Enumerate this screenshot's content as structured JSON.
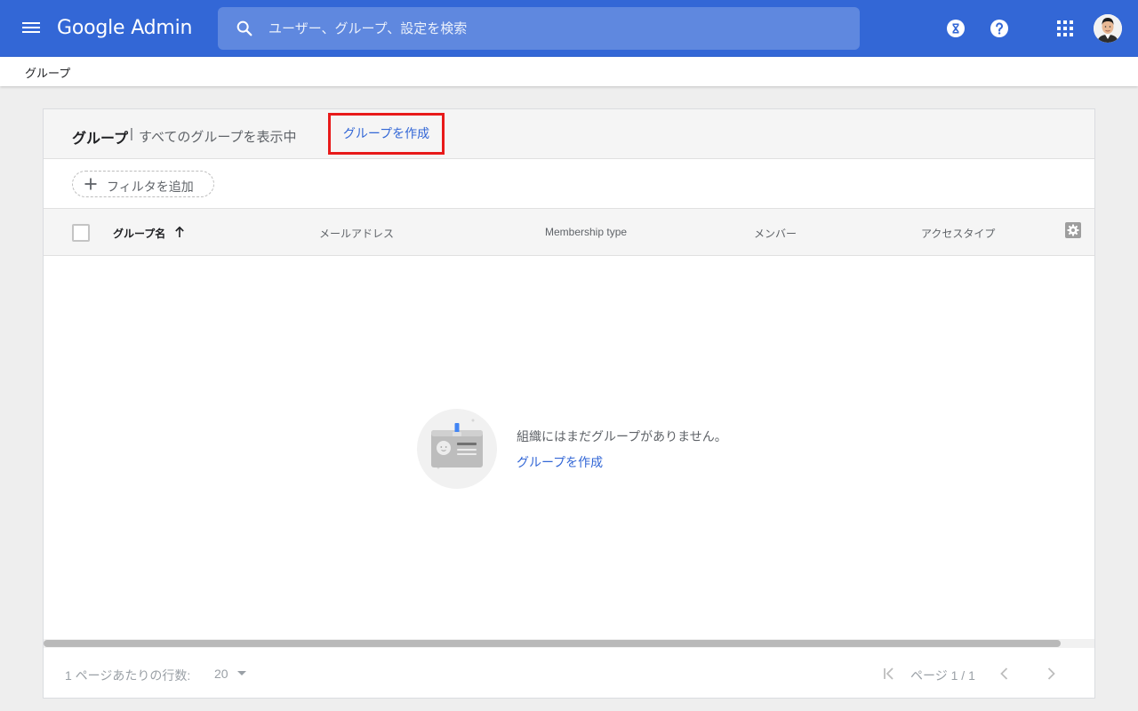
{
  "app": {
    "logo_google": "Google",
    "logo_admin": "Admin"
  },
  "search": {
    "placeholder": "ユーザー、グループ、設定を検索"
  },
  "icons": {
    "menu": "menu-icon",
    "search": "search-icon",
    "hourglass": "hourglass-icon",
    "help": "help-icon",
    "apps": "apps-grid-icon",
    "avatar": "user-avatar",
    "add": "plus-icon",
    "sort": "arrow-up-icon",
    "settings": "gear-icon",
    "first_page": "first-page-icon",
    "prev_page": "chevron-left-icon",
    "next_page": "chevron-right-icon"
  },
  "colors": {
    "appbar": "#3367d6",
    "link": "#3367d6",
    "highlight_border": "#e81a1a"
  },
  "breadcrumb": "グループ",
  "card": {
    "title": "グループ",
    "separator": "|",
    "subtitle": "すべてのグループを表示中",
    "create_label": "グループを作成"
  },
  "filter": {
    "label": "フィルタを追加"
  },
  "table": {
    "columns": [
      "グループ名",
      "メールアドレス",
      "Membership type",
      "メンバー",
      "アクセスタイプ"
    ]
  },
  "empty_state": {
    "message": "組織にはまだグループがありません。",
    "link_label": "グループを作成"
  },
  "pagination": {
    "rows_label": "1 ページあたりの行数:",
    "rows_value": "20",
    "page_label": "ページ 1 / 1"
  }
}
